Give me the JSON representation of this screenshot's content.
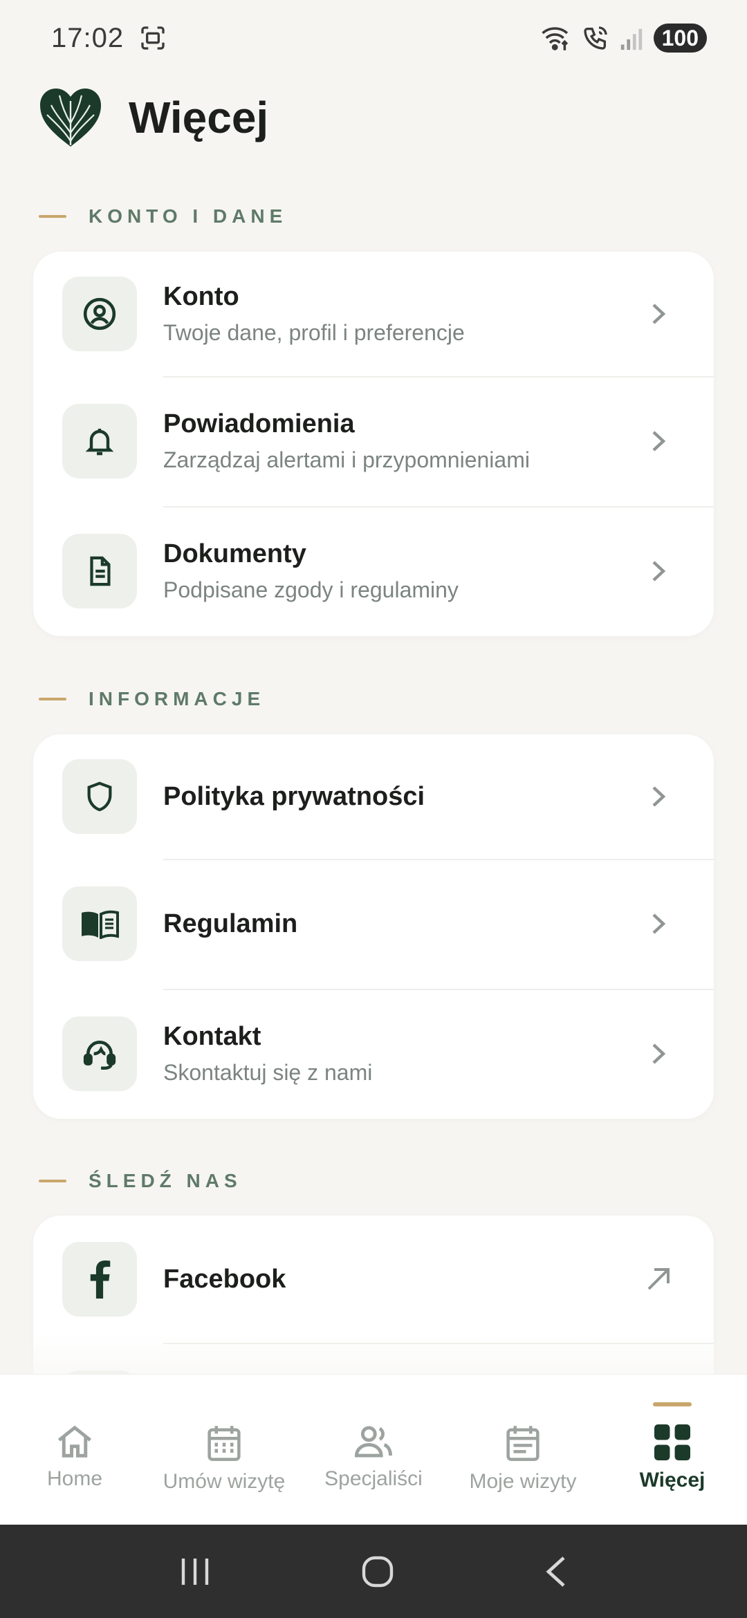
{
  "status_bar": {
    "time": "17:02",
    "battery": "100",
    "icons": [
      "screenshot-icon",
      "wifi-calling-icon",
      "volte-call-icon",
      "signal-icon"
    ]
  },
  "header": {
    "title": "Więcej",
    "logo": "heart-leaf-logo"
  },
  "sections": [
    {
      "label": "KONTO I DANE",
      "items": [
        {
          "title": "Konto",
          "subtitle": "Twoje dane, profil i preferencje",
          "icon": "user-circle-icon",
          "action": "chevron-right-icon"
        },
        {
          "title": "Powiadomienia",
          "subtitle": "Zarządzaj alertami i przypomnieniami",
          "icon": "bell-icon",
          "action": "chevron-right-icon"
        },
        {
          "title": "Dokumenty",
          "subtitle": "Podpisane zgody i regulaminy",
          "icon": "document-icon",
          "action": "chevron-right-icon"
        }
      ]
    },
    {
      "label": "INFORMACJE",
      "items": [
        {
          "title": "Polityka prywatności",
          "icon": "shield-icon",
          "action": "chevron-right-icon"
        },
        {
          "title": "Regulamin",
          "icon": "book-icon",
          "action": "chevron-right-icon"
        },
        {
          "title": "Kontakt",
          "subtitle": "Skontaktuj się z nami",
          "icon": "support-headset-icon",
          "action": "chevron-right-icon"
        }
      ]
    },
    {
      "label": "ŚLEDŹ NAS",
      "items": [
        {
          "title": "Facebook",
          "icon": "facebook-icon",
          "action": "external-link-icon"
        }
      ]
    }
  ],
  "bottom_nav": {
    "items": [
      {
        "label": "Home",
        "icon": "home-icon",
        "active": false
      },
      {
        "label": "Umów wizytę",
        "icon": "calendar-grid-icon",
        "active": false
      },
      {
        "label": "Specjaliści",
        "icon": "people-icon",
        "active": false
      },
      {
        "label": "Moje wizyty",
        "icon": "calendar-list-icon",
        "active": false
      },
      {
        "label": "Więcej",
        "icon": "grid-icon",
        "active": true
      }
    ]
  },
  "system_nav": {
    "items": [
      "recent-apps-icon",
      "home-circle-icon",
      "back-icon"
    ]
  },
  "colors": {
    "background": "#f6f5f2",
    "brand_green": "#1b3a2a",
    "accent_gold": "#c9a66b",
    "section_label": "#5f7a68",
    "muted_text": "#7b8480"
  }
}
